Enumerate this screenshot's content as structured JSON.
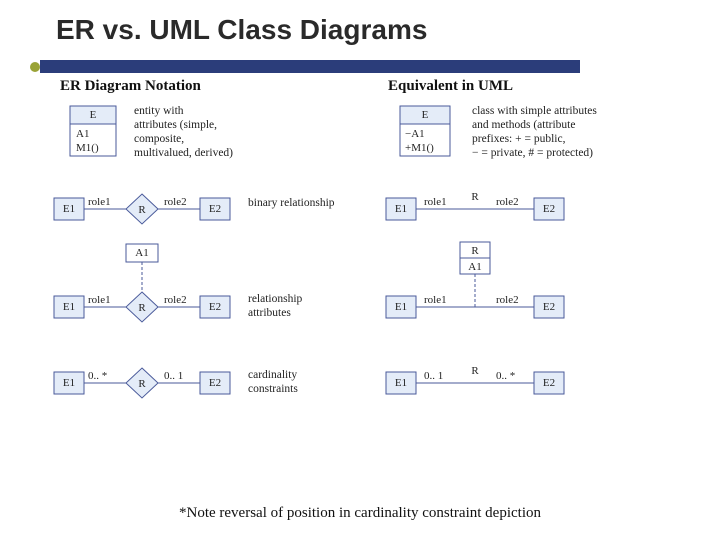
{
  "title": "ER vs. UML Class Diagrams",
  "columns": {
    "left": "ER Diagram Notation",
    "right": "Equivalent in UML"
  },
  "er": {
    "entity": {
      "name": "E",
      "attrs": [
        "A1",
        "M1()"
      ],
      "desc": [
        "entity with",
        "attributes (simple,",
        "composite,",
        "multivalued, derived)"
      ]
    },
    "binary": {
      "e1": "E1",
      "e2": "E2",
      "r": "R",
      "role1": "role1",
      "role2": "role2",
      "desc": "binary relationship"
    },
    "relattr": {
      "e1": "E1",
      "e2": "E2",
      "r": "R",
      "a": "A1",
      "role1": "role1",
      "role2": "role2",
      "desc": [
        "relationship",
        "attributes"
      ]
    },
    "card": {
      "e1": "E1",
      "e2": "E2",
      "r": "R",
      "c1": "0.. *",
      "c2": "0.. 1",
      "desc": [
        "cardinality",
        "constraints"
      ]
    }
  },
  "uml": {
    "class": {
      "name": "E",
      "attrs": [
        "−A1",
        "+M1()"
      ],
      "desc": [
        "class with simple attributes",
        "and methods (attribute",
        "prefixes: + = public,",
        "− = private, # = protected)"
      ]
    },
    "binary": {
      "e1": "E1",
      "e2": "E2",
      "r": "R",
      "role1": "role1",
      "role2": "role2"
    },
    "relattr": {
      "e1": "E1",
      "e2": "E2",
      "r": "R",
      "a": "A1",
      "role1": "role1",
      "role2": "role2"
    },
    "card": {
      "e1": "E1",
      "e2": "E2",
      "r": "R",
      "c1": "0.. 1",
      "c2": "0.. *"
    }
  },
  "footnote": "*Note reversal of position in cardinality constraint depiction"
}
